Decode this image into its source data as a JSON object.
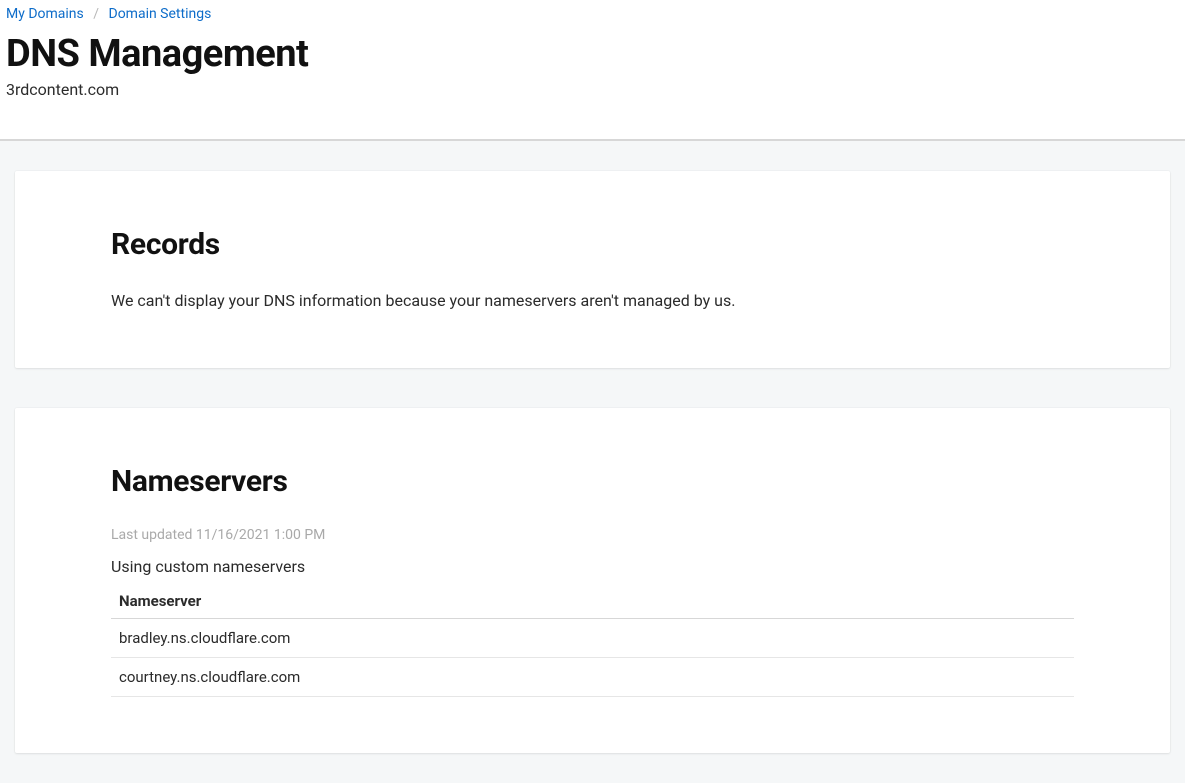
{
  "breadcrumb": {
    "items": [
      {
        "label": "My Domains"
      },
      {
        "label": "Domain Settings"
      }
    ]
  },
  "page": {
    "title": "DNS Management",
    "domain": "3rdcontent.com"
  },
  "records": {
    "heading": "Records",
    "message": "We can't display your DNS information because your nameservers aren't managed by us."
  },
  "nameservers": {
    "heading": "Nameservers",
    "last_updated_label": "Last updated 11/16/2021 1:00 PM",
    "subtitle": "Using custom nameservers",
    "column_header": "Nameserver",
    "rows": [
      "bradley.ns.cloudflare.com",
      "courtney.ns.cloudflare.com"
    ]
  }
}
